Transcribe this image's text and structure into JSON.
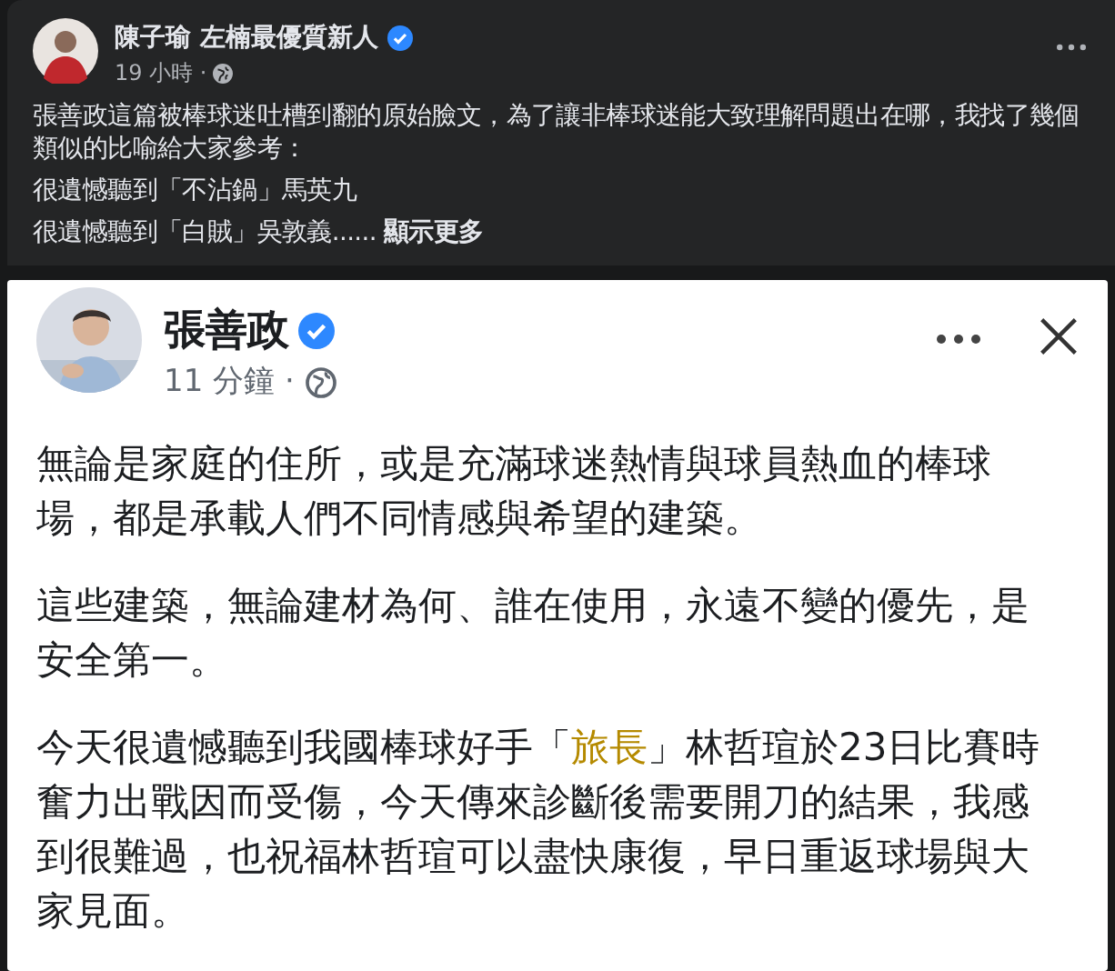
{
  "post": {
    "author": "陳子瑜 左楠最優質新人",
    "verified": true,
    "time": "19 小時 ·",
    "paragraphs": [
      "張善政這篇被棒球迷吐槽到翻的原始臉文，為了讓非棒球迷能大致理解問題出在哪，我找了幾個類似的比喻給大家參考：",
      "很遺憾聽到「不沾鍋」馬英九",
      "很遺憾聽到「白賊」吳敦義......"
    ],
    "see_more": "顯示更多"
  },
  "shared_screenshot": {
    "author": "張善政",
    "verified": true,
    "time": "11 分鐘 ·",
    "paragraphs": [
      [
        {
          "text": "無論是家庭的住所，或是充滿球迷熱情與球員熱血的棒球場，都是承載人們不同情感與希望的建築。",
          "highlighted": false
        }
      ],
      [
        {
          "text": "這些建築，無論建材為何、誰在使用，永遠不變的優先，是安全第一。",
          "highlighted": false
        }
      ],
      [
        {
          "text": "今天很遺憾聽到我國棒球好手「",
          "highlighted": false
        },
        {
          "text": "旅長",
          "highlighted": true
        },
        {
          "text": "」林哲瑄於23日比賽時奮力出戰因而受傷，今天傳來診斷後需要開刀的結果，我感到很難過，也祝福林哲瑄可以盡快康復，早日重返球場與大家見面。",
          "highlighted": false
        }
      ]
    ]
  }
}
